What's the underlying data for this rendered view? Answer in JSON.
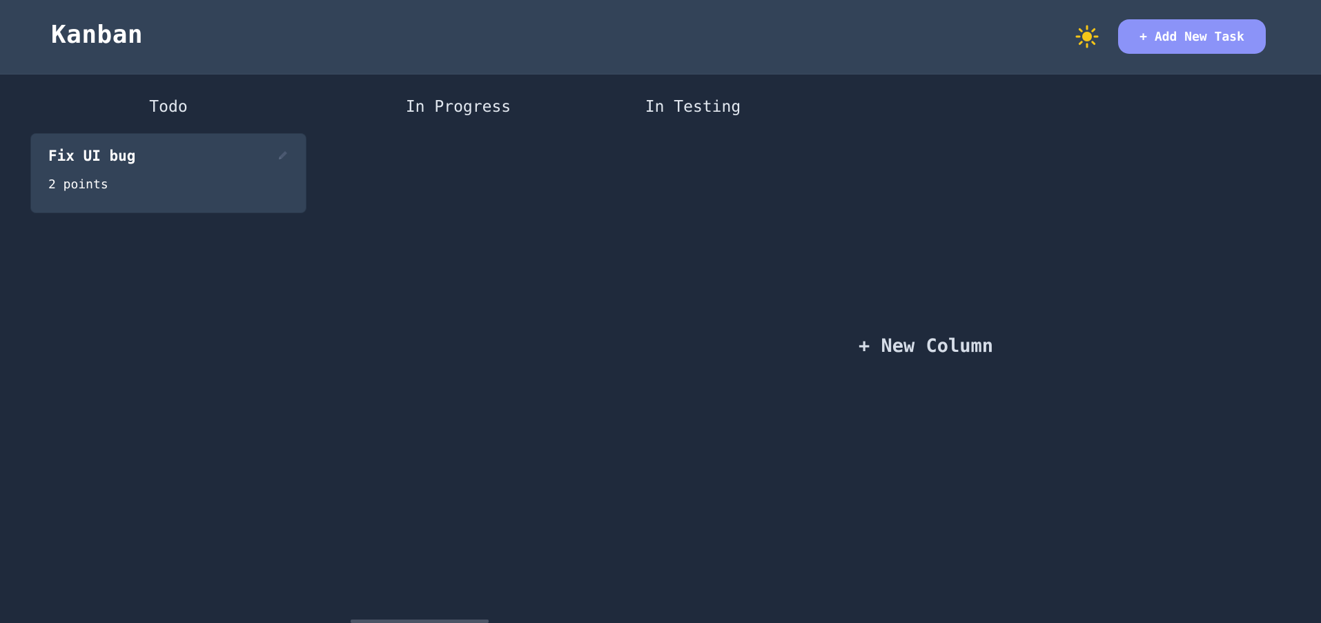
{
  "header": {
    "title": "Kanban",
    "theme_icon": "sun-icon",
    "add_task_label": "+ Add New Task"
  },
  "columns": [
    {
      "title": "Todo"
    },
    {
      "title": "In Progress"
    },
    {
      "title": "In Testing"
    }
  ],
  "tasks": [
    {
      "title": "Fix UI bug",
      "points": "2 points",
      "edit_icon": "pencil-icon"
    }
  ],
  "new_column_label": "+ New Column",
  "colors": {
    "background": "#1f2a3c",
    "header": "#334358",
    "card": "#334358",
    "accent": "#8b93f8",
    "sun": "#f5c518"
  }
}
